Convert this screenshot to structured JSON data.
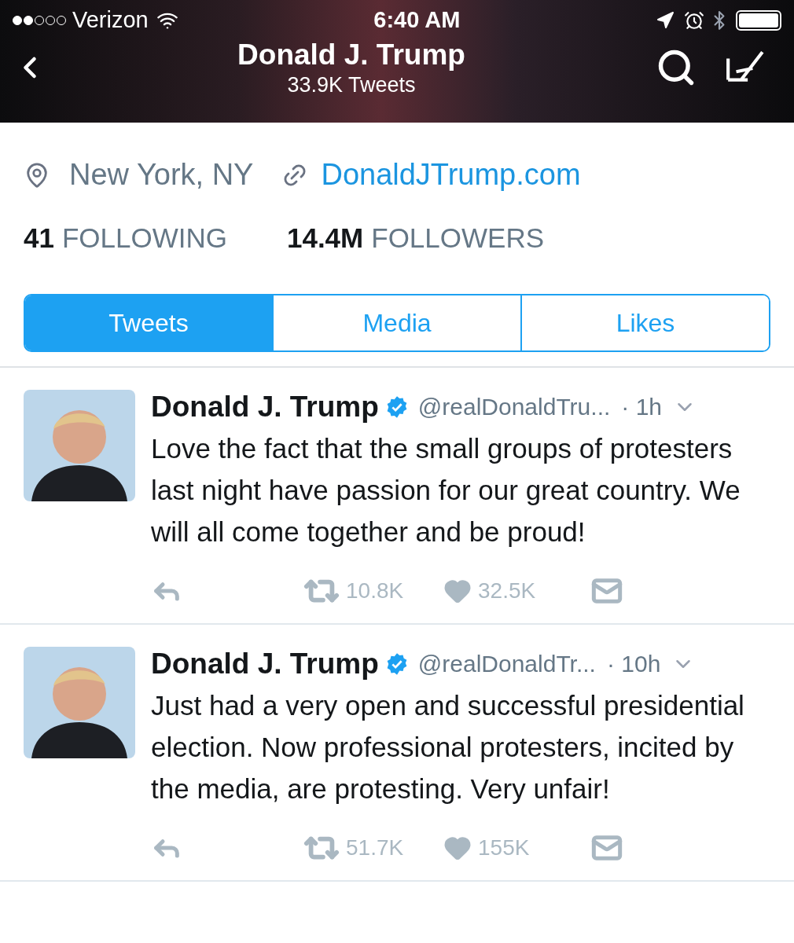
{
  "status_bar": {
    "carrier": "Verizon",
    "time": "6:40 AM"
  },
  "header": {
    "title": "Donald J. Trump",
    "subtitle": "33.9K Tweets"
  },
  "profile": {
    "location": "New York, NY",
    "website": "DonaldJTrump.com",
    "stats": [
      {
        "count": "41",
        "label": "FOLLOWING"
      },
      {
        "count": "14.4M",
        "label": "FOLLOWERS"
      }
    ]
  },
  "tabs": [
    {
      "label": "Tweets",
      "selected": true
    },
    {
      "label": "Media",
      "selected": false
    },
    {
      "label": "Likes",
      "selected": false
    }
  ],
  "tweets": [
    {
      "name": "Donald J. Trump",
      "verified": true,
      "handle": "@realDonaldTru...",
      "time": "· 1h",
      "text": "Love the fact that the small groups of protesters last night have passion for our great country. We will all come together and be proud!",
      "retweets": "10.8K",
      "likes": "32.5K"
    },
    {
      "name": "Donald J. Trump",
      "verified": true,
      "handle": "@realDonaldTr...",
      "time": "· 10h",
      "text": "Just had a very open and successful presidential election. Now professional protesters, incited by the media, are protesting. Very unfair!",
      "retweets": "51.7K",
      "likes": "155K"
    }
  ]
}
